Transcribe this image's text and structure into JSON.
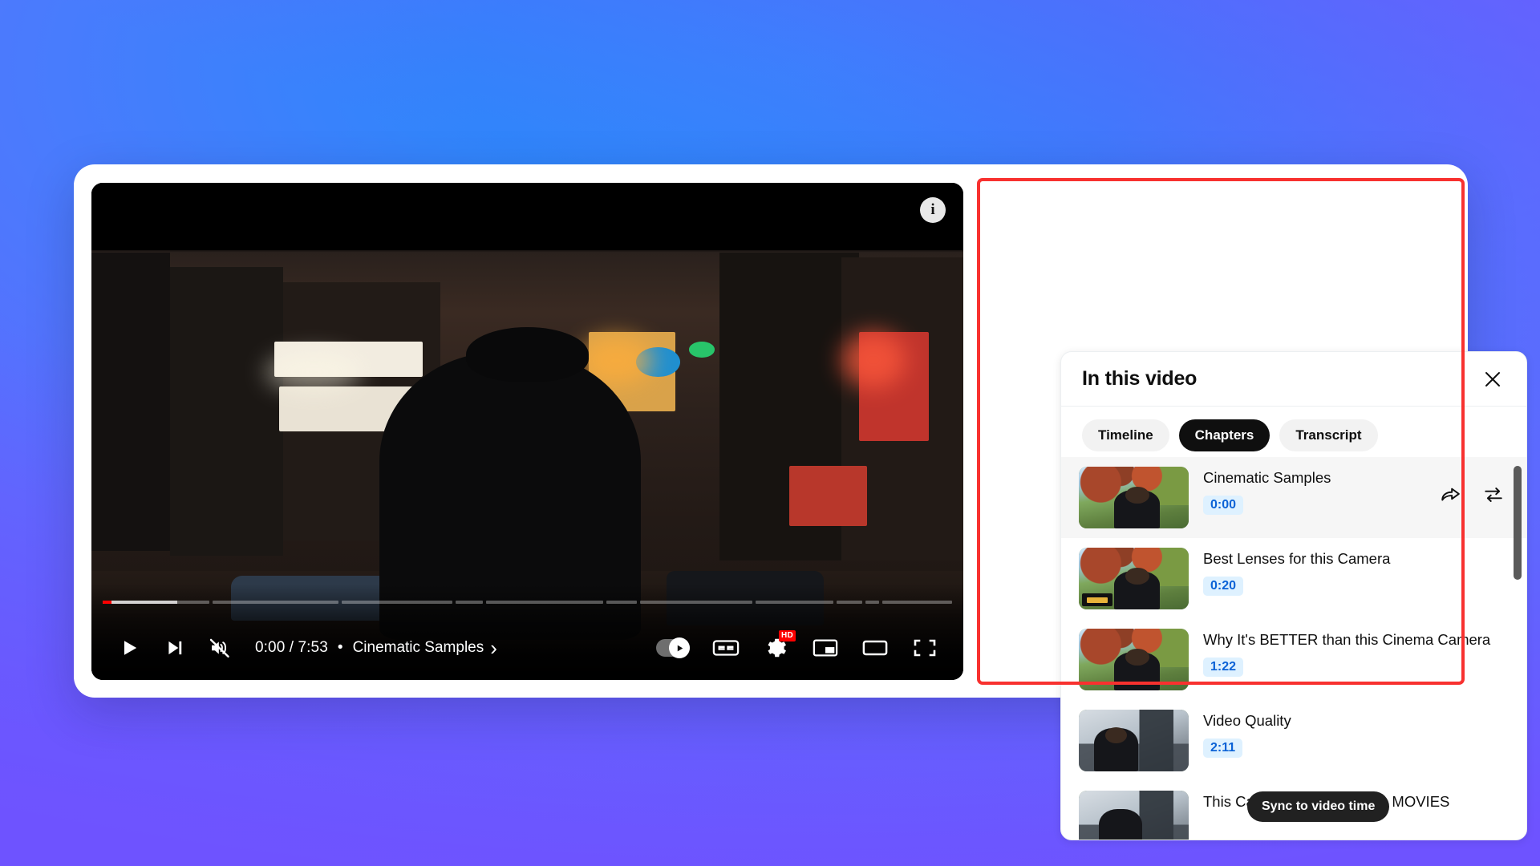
{
  "background": {
    "accent_purple": "#6e53ff",
    "accent_blue": "#2d8cfc"
  },
  "player": {
    "info_icon_label": "i",
    "controls": {
      "play_label": "Play",
      "next_label": "Next",
      "mute_label": "Unmute",
      "time_current": "0:00",
      "time_total": "7:53",
      "time_display": "0:00 / 7:53",
      "separator": "•",
      "chapter_name": "Cinematic Samples",
      "chapter_chevron": "›",
      "autoplay_label": "Autoplay",
      "captions_label": "CC",
      "settings_label": "Settings",
      "settings_badge": "HD",
      "miniplayer_label": "Miniplayer",
      "theater_label": "Theater mode",
      "fullscreen_label": "Full screen"
    },
    "progress": {
      "played_percent": 1.2,
      "buffered_percent": 11.0,
      "segments": [
        12.6,
        14.8,
        13.0,
        3.2,
        13.8,
        3.6,
        13.2,
        9.2,
        3.0,
        1.6,
        5.0,
        0.0
      ]
    }
  },
  "panel": {
    "title": "In this video",
    "close_label": "Close",
    "tabs": [
      {
        "label": "Timeline",
        "active": false
      },
      {
        "label": "Chapters",
        "active": true
      },
      {
        "label": "Transcript",
        "active": false
      }
    ],
    "chapters": [
      {
        "title": "Cinematic Samples",
        "time": "0:00",
        "active": true,
        "actions": [
          "share-icon",
          "loop-icon"
        ]
      },
      {
        "title": "Best Lenses for this Camera",
        "time": "0:20",
        "active": false,
        "actions": []
      },
      {
        "title": "Why It's BETTER than this Cinema Camera",
        "time": "1:22",
        "active": false,
        "actions": []
      },
      {
        "title": "Video Quality",
        "time": "2:11",
        "active": false,
        "actions": []
      },
      {
        "title": "This Camera Makes Filming MOVIES",
        "time": "",
        "active": false,
        "actions": []
      }
    ],
    "tooltip": "Sync to video time"
  }
}
